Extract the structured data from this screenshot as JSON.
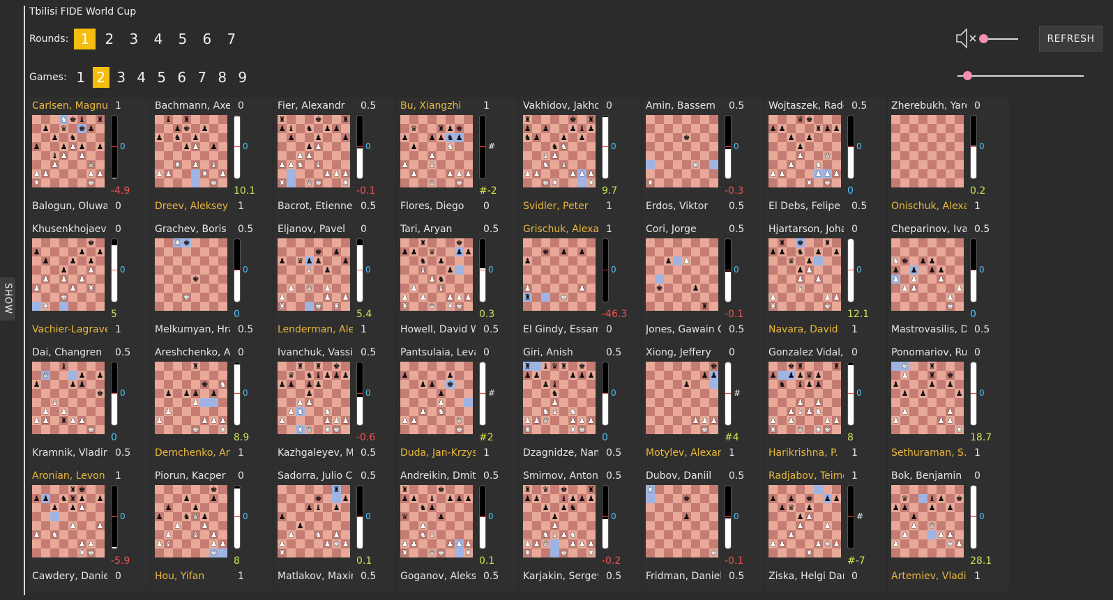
{
  "app": {
    "title": "Tbilisi FIDE World Cup",
    "show_label": "SHOW",
    "refresh_label": "REFRESH"
  },
  "rounds": {
    "label": "Rounds:",
    "items": [
      "1",
      "2",
      "3",
      "4",
      "5",
      "6",
      "7"
    ],
    "active": 0
  },
  "games": {
    "label": "Games:",
    "items": [
      "1",
      "2",
      "3",
      "4",
      "5",
      "6",
      "7",
      "8",
      "9"
    ],
    "active": 1
  },
  "volume": {
    "muted": true,
    "level": 0
  },
  "speed": {
    "level": 0.08
  },
  "colors": {
    "accent": "#f4bd0f",
    "winner": "#eab73c",
    "positive": "#c6e35a",
    "negative": "#ef5350",
    "zero": "#4fc3f7"
  },
  "matches": [
    {
      "top": {
        "name": "Carlsen, Magnus",
        "score": "1",
        "win": true
      },
      "bottom": {
        "name": "Balogun, Oluwafemi",
        "score": "0",
        "win": false
      },
      "eval_text": "-4.9",
      "eval_kind": "neg",
      "bar": 0.01,
      "marker": "0"
    },
    {
      "top": {
        "name": "Bachmann, Axel",
        "score": "0",
        "win": false
      },
      "bottom": {
        "name": "Dreev, Aleksey",
        "score": "1",
        "win": true
      },
      "eval_text": "10.1",
      "eval_kind": "pos",
      "bar": 0.99,
      "marker": "0"
    },
    {
      "top": {
        "name": "Fier, Alexandr",
        "score": "0.5",
        "win": false
      },
      "bottom": {
        "name": "Bacrot, Etienne",
        "score": "0.5",
        "win": false
      },
      "eval_text": "-0.1",
      "eval_kind": "neg",
      "bar": 0.48,
      "marker": "0"
    },
    {
      "top": {
        "name": "Bu, Xiangzhi",
        "score": "1",
        "win": true
      },
      "bottom": {
        "name": "Flores, Diego",
        "score": "0",
        "win": false
      },
      "eval_text": "#-2",
      "eval_kind": "mate",
      "bar": 0.0,
      "marker": "#"
    },
    {
      "top": {
        "name": "Vakhidov, Jakhongir",
        "score": "0",
        "win": false
      },
      "bottom": {
        "name": "Svidler, Peter",
        "score": "1",
        "win": true
      },
      "eval_text": "9.7",
      "eval_kind": "pos",
      "bar": 0.98,
      "marker": "0"
    },
    {
      "top": {
        "name": "Amin, Bassem",
        "score": "0.5",
        "win": false
      },
      "bottom": {
        "name": "Erdos, Viktor",
        "score": "0.5",
        "win": false
      },
      "eval_text": "-0.3",
      "eval_kind": "neg",
      "bar": 0.47,
      "marker": "0"
    },
    {
      "top": {
        "name": "Wojtaszek, Radoslaw",
        "score": "0.5",
        "win": false
      },
      "bottom": {
        "name": "El Debs, Felipe de Cresce",
        "score": "0.5",
        "win": false
      },
      "eval_text": "0",
      "eval_kind": "zero",
      "bar": 0.5,
      "marker": "0"
    },
    {
      "top": {
        "name": "Zherebukh, Yaroslav",
        "score": "0",
        "win": false
      },
      "bottom": {
        "name": "Onischuk, Alexander",
        "score": "1",
        "win": true
      },
      "eval_text": "0.2",
      "eval_kind": "pos",
      "bar": 0.52,
      "marker": "0"
    },
    {
      "top": {
        "name": "Khusenkhojaev, Muhammad",
        "score": "0",
        "win": false
      },
      "bottom": {
        "name": "Vachier-Lagrave, Maxime",
        "score": "1",
        "win": true
      },
      "eval_text": "5",
      "eval_kind": "pos",
      "bar": 0.9,
      "marker": "0"
    },
    {
      "top": {
        "name": "Grachev, Boris",
        "score": "0.5",
        "win": false
      },
      "bottom": {
        "name": "Melkumyan, Hrant",
        "score": "0.5",
        "win": false
      },
      "eval_text": "0",
      "eval_kind": "zero",
      "bar": 0.5,
      "marker": "0"
    },
    {
      "top": {
        "name": "Eljanov, Pavel",
        "score": "0",
        "win": false
      },
      "bottom": {
        "name": "Lenderman, Aleksandr",
        "score": "1",
        "win": true
      },
      "eval_text": "5.4",
      "eval_kind": "pos",
      "bar": 0.9,
      "marker": "0"
    },
    {
      "top": {
        "name": "Tari, Aryan",
        "score": "0.5",
        "win": false
      },
      "bottom": {
        "name": "Howell, David W L",
        "score": "0.5",
        "win": false
      },
      "eval_text": "0.3",
      "eval_kind": "pos",
      "bar": 0.53,
      "marker": "0"
    },
    {
      "top": {
        "name": "Grischuk, Alexander",
        "score": "1",
        "win": true
      },
      "bottom": {
        "name": "El Gindy, Essam",
        "score": "0",
        "win": false
      },
      "eval_text": "-46.3",
      "eval_kind": "neg",
      "bar": 0.0,
      "marker": "0"
    },
    {
      "top": {
        "name": "Cori, Jorge",
        "score": "0.5",
        "win": false
      },
      "bottom": {
        "name": "Jones, Gawain C B",
        "score": "0.5",
        "win": false
      },
      "eval_text": "-0.1",
      "eval_kind": "neg",
      "bar": 0.48,
      "marker": "0"
    },
    {
      "top": {
        "name": "Hjartarson, Johann",
        "score": "0",
        "win": false
      },
      "bottom": {
        "name": "Navara, David",
        "score": "1",
        "win": true
      },
      "eval_text": "12.1",
      "eval_kind": "pos",
      "bar": 1.0,
      "marker": "0"
    },
    {
      "top": {
        "name": "Cheparinov, Ivan",
        "score": "0.5",
        "win": false
      },
      "bottom": {
        "name": "Mastrovasilis, Dimitrios",
        "score": "0.5",
        "win": false
      },
      "eval_text": "0",
      "eval_kind": "zero",
      "bar": 0.5,
      "marker": "0"
    },
    {
      "top": {
        "name": "Dai, Changren",
        "score": "0.5",
        "win": false
      },
      "bottom": {
        "name": "Kramnik, Vladimir",
        "score": "0.5",
        "win": false
      },
      "eval_text": "0",
      "eval_kind": "zero",
      "bar": 0.5,
      "marker": "0"
    },
    {
      "top": {
        "name": "Areshchenko, Alexander",
        "score": "0",
        "win": false
      },
      "bottom": {
        "name": "Demchenko, Anton",
        "score": "1",
        "win": true
      },
      "eval_text": "8.9",
      "eval_kind": "pos",
      "bar": 0.97,
      "marker": "0"
    },
    {
      "top": {
        "name": "Ivanchuk, Vassily",
        "score": "0.5",
        "win": false
      },
      "bottom": {
        "name": "Kazhgaleyev, Murtas",
        "score": "0.5",
        "win": false
      },
      "eval_text": "-0.6",
      "eval_kind": "neg",
      "bar": 0.45,
      "marker": "0"
    },
    {
      "top": {
        "name": "Pantsulaia, Levan",
        "score": "0",
        "win": false
      },
      "bottom": {
        "name": "Duda, Jan-Krzysztof",
        "score": "1",
        "win": true
      },
      "eval_text": "#2",
      "eval_kind": "mate",
      "bar": 1.0,
      "marker": "#"
    },
    {
      "top": {
        "name": "Giri, Anish",
        "score": "0.5",
        "win": false
      },
      "bottom": {
        "name": "Dzagnidze, Nana",
        "score": "0.5",
        "win": false
      },
      "eval_text": "0",
      "eval_kind": "zero",
      "bar": 0.5,
      "marker": "0"
    },
    {
      "top": {
        "name": "Xiong, Jeffery",
        "score": "0",
        "win": false
      },
      "bottom": {
        "name": "Motylev, Alexander",
        "score": "1",
        "win": true
      },
      "eval_text": "#4",
      "eval_kind": "mate",
      "bar": 1.0,
      "marker": "#"
    },
    {
      "top": {
        "name": "Gonzalez Vidal, Yuri",
        "score": "0",
        "win": false
      },
      "bottom": {
        "name": "Harikrishna, P.",
        "score": "1",
        "win": true
      },
      "eval_text": "8",
      "eval_kind": "pos",
      "bar": 0.96,
      "marker": "0"
    },
    {
      "top": {
        "name": "Ponomariov, Ruslan",
        "score": "0",
        "win": false
      },
      "bottom": {
        "name": "Sethuraman, S.P.",
        "score": "1",
        "win": true
      },
      "eval_text": "18.7",
      "eval_kind": "pos",
      "bar": 1.0,
      "marker": "0"
    },
    {
      "top": {
        "name": "Aronian, Levon",
        "score": "1",
        "win": true
      },
      "bottom": {
        "name": "Cawdery, Daniel",
        "score": "0",
        "win": false
      },
      "eval_text": "-5.9",
      "eval_kind": "neg",
      "bar": 0.02,
      "marker": "0"
    },
    {
      "top": {
        "name": "Piorun, Kacper",
        "score": "0",
        "win": false
      },
      "bottom": {
        "name": "Hou, Yifan",
        "score": "1",
        "win": true
      },
      "eval_text": "8",
      "eval_kind": "pos",
      "bar": 0.96,
      "marker": "0"
    },
    {
      "top": {
        "name": "Sadorra, Julio Catalino",
        "score": "0.5",
        "win": false
      },
      "bottom": {
        "name": "Matlakov, Maxim",
        "score": "0.5",
        "win": false
      },
      "eval_text": "0.1",
      "eval_kind": "pos",
      "bar": 0.51,
      "marker": "0"
    },
    {
      "top": {
        "name": "Andreikin, Dmitry",
        "score": "0.5",
        "win": false
      },
      "bottom": {
        "name": "Goganov, Aleksey",
        "score": "0.5",
        "win": false
      },
      "eval_text": "0.1",
      "eval_kind": "pos",
      "bar": 0.51,
      "marker": "0"
    },
    {
      "top": {
        "name": "Smirnov, Anton",
        "score": "0.5",
        "win": false
      },
      "bottom": {
        "name": "Karjakin, Sergey",
        "score": "0.5",
        "win": false
      },
      "eval_text": "-0.2",
      "eval_kind": "neg",
      "bar": 0.47,
      "marker": "0"
    },
    {
      "top": {
        "name": "Dubov, Daniil",
        "score": "0.5",
        "win": false
      },
      "bottom": {
        "name": "Fridman, Daniel",
        "score": "0.5",
        "win": false
      },
      "eval_text": "-0.1",
      "eval_kind": "neg",
      "bar": 0.48,
      "marker": "0"
    },
    {
      "top": {
        "name": "Radjabov, Teimour",
        "score": "1",
        "win": true
      },
      "bottom": {
        "name": "Ziska, Helgi Dam",
        "score": "0",
        "win": false
      },
      "eval_text": "#-7",
      "eval_kind": "mate",
      "bar": 0.0,
      "marker": "#"
    },
    {
      "top": {
        "name": "Bok, Benjamin",
        "score": "0",
        "win": false
      },
      "bottom": {
        "name": "Artemiev, Vladislav",
        "score": "1",
        "win": true
      },
      "eval_text": "28.1",
      "eval_kind": "pos",
      "bar": 1.0,
      "marker": "0"
    }
  ],
  "boards": [
    "3Nkb1r/1p1q1kp1/2p1n3/p2pPp1p/2bP1P2/2P3Q1/PP4PP/R5K1",
    "1b1r4/2pk1p2/p1n1p3/3pP1p1/8/2R1P1B1/PP3R1P/6K1",
    "r3k2r/pb1n1pp1/1p2p2p/3pP3/2PP4/PPN1B3/5PPP/R2QK2R",
    "8/1q2rpk1/p2ppnp1/1p3N2/3P4/P2B4/1P3PPP/3Q2K1",
    "r4k1r/p1p2pbp/np2p1p1/3nN3/2BP4/2N1B3/PP3PPP/2KR3R",
    "8/8/4k3/8/8/5K2/8/R7",
    "3qk3/pp3rpp/2p1p3/3p4/3P2Q1/2P2N2/PP3PPP/4R1K1",
    "8/8/8/8/8/8/8/8",
    "6k1/p4p1p/1p2p1p1/3p2P1/1P1P1P2/P3P1R1/3K4/1R6",
    "2Rk4/8/8/8/4k3/8/3K4/8",
    "8/4k1p1/p1qpp2p/3B1p2/8/1P1Q1P2/P4P1P/R3K1R1",
    "2r3k1/pp1q2pp/2n1p3/2B2p2/3Pn3/1P2B3/P1P2PPP/R2Q1RK1",
    "8/2k1p1p1/p7/8/8/P5P1/r3K3/8",
    "8/8/2p1P3/8/8/1k3p2/8/6r1",
    "1r1k2r1/pp1n1p1p/2q1p3/3pP3/3P1P2/3B4/P5PP/R5K1",
    "8/8/Nk1pp3/p1p1pp2/P1P2P2/1PP4P/6P1/6K1",
    "3b4/1Q3p1p/p3pp2/7k/2B5/1P1P4/PP1rPP2/6K1",
    "4r3/8/5k1N/1p1pp1p1/4P3/1P6/P4PPP/4K2R",
    "2r1r1k1/1q1nbppp/pp1pp3/3p4/2PP4/1PN2N2/P4PPP/2RQ1RK1",
    "8/p4p2/2pp1k2/4p3/4P3/2P1N3/PP4Q1/6K1",
    "r1bqr1k1/pp3ppp/2pb4/3n4/3P4/2NB1N2/PPQ2PPP/R4RK1",
    "7k/6pp/4p3/8/8/8/5PPP/6K1",
    "2kr3r/p1ppqp2/1n1bpp2/8/3P1P2/2PBPN2/P1P3PP/R2Q1RK1",
    "1K2r3/1P2r1k1/p3p1p1/1p1p3p/8/1P4P1/P4PP1/7R",
    "4rk2/pp1nrp1p/2p1pP2/8/4P2P/P1N5/5PP1/5RK1",
    "6k1/3p2p1/1p2p3/p2nQp2/2P2P2/1P2B1P1/PB4PP/6K1",
    "6r1/4k2p/3pb1p1/p7/2p5/1P2N1P1/P4PKP/R7",
    "r3k3/pp1b1ppp/2np4/q3p3/2P5/2NB4/PP3PPP/R2QK2R",
    "r1q1k2r/pp2bppp/2p1pn2/3p4/3P4/2NBPN2/PPQ2PPP/R3K2R",
    "R7/4k3/8/4p3/8/8/8/7K",
    "8/p1p1k1pp/1pq1p3/3pP3/3P2P1/2P5/PP3PKP/4R3",
    "8/1q2bp1k/pp2p1p1/2p5/2P1Q3/1P3PP1/P5KP/8"
  ],
  "highlights": [
    [
      [
        0,
        3
      ],
      [
        1,
        5
      ]
    ],
    [
      [
        6,
        4
      ],
      [
        7,
        4
      ]
    ],
    [
      [
        7,
        1
      ],
      [
        6,
        1
      ]
    ],
    [
      [
        2,
        5
      ],
      [
        2,
        6
      ]
    ],
    [
      [
        6,
        6
      ],
      [
        7,
        6
      ]
    ],
    [
      [
        5,
        0
      ],
      [
        5,
        7
      ]
    ],
    [
      [
        6,
        5
      ],
      [
        6,
        6
      ]
    ],
    [],
    [
      [
        7,
        0
      ],
      [
        7,
        3
      ]
    ],
    [
      [
        0,
        2
      ],
      [
        0,
        3
      ]
    ],
    [
      [
        2,
        3
      ],
      [
        7,
        3
      ]
    ],
    [
      [
        1,
        6
      ],
      [
        3,
        6
      ]
    ],
    [
      [
        6,
        0
      ],
      [
        6,
        2
      ]
    ],
    [
      [
        4,
        1
      ],
      [
        2,
        3
      ]
    ],
    [
      [
        0,
        3
      ],
      [
        2,
        5
      ]
    ],
    [
      [
        3,
        2
      ],
      [
        4,
        0
      ]
    ],
    [
      [
        1,
        1
      ],
      [
        1,
        4
      ]
    ],
    [
      [
        4,
        6
      ],
      [
        4,
        5
      ]
    ],
    [
      [
        7,
        2
      ],
      [
        5,
        2
      ]
    ],
    [
      [
        2,
        5
      ],
      [
        4,
        7
      ]
    ],
    [
      [
        0,
        0
      ],
      [
        0,
        1
      ]
    ],
    [
      [
        1,
        7
      ],
      [
        2,
        7
      ]
    ],
    [
      [
        1,
        1
      ],
      [
        1,
        2
      ]
    ],
    [
      [
        0,
        0
      ],
      [
        0,
        1
      ]
    ],
    [
      [
        1,
        1
      ],
      [
        3,
        2
      ]
    ],
    [
      [
        7,
        6
      ],
      [
        7,
        7
      ]
    ],
    [
      [
        0,
        6
      ],
      [
        1,
        6
      ]
    ],
    [
      [
        7,
        6
      ],
      [
        6,
        6
      ]
    ],
    [
      [
        6,
        3
      ],
      [
        7,
        3
      ]
    ],
    [
      [
        0,
        0
      ],
      [
        1,
        0
      ]
    ],
    [
      [
        0,
        5
      ],
      [
        1,
        6
      ]
    ],
    [
      [
        1,
        3
      ],
      [
        5,
        4
      ]
    ]
  ]
}
